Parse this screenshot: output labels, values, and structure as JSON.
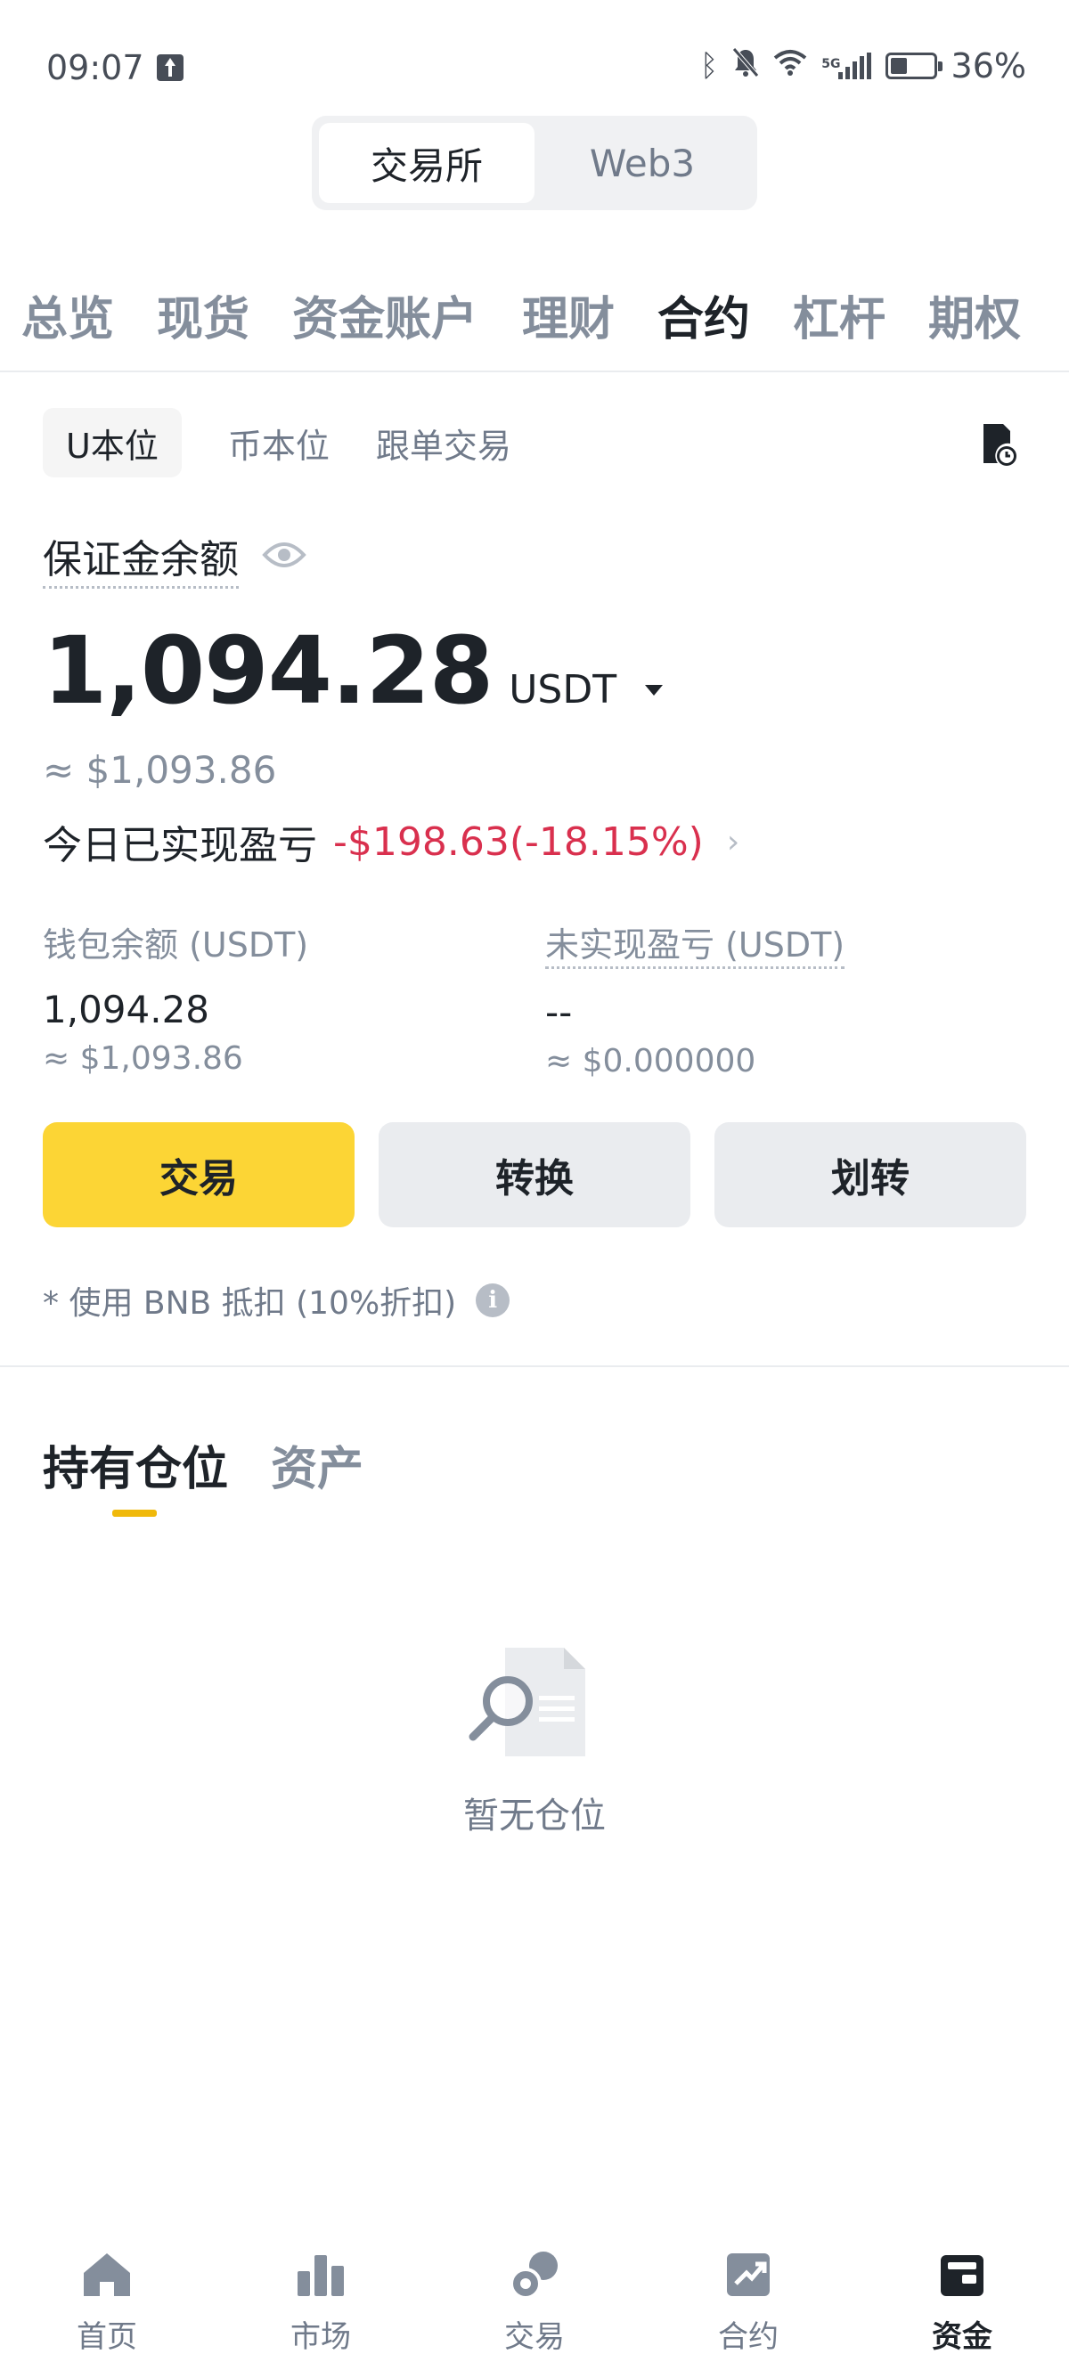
{
  "status_bar": {
    "time": "09:07",
    "network": "5G",
    "battery": "36%"
  },
  "segment": {
    "items": [
      "交易所",
      "Web3"
    ],
    "active_index": 0
  },
  "main_tabs": [
    "总览",
    "现货",
    "资金账户",
    "理财",
    "合约",
    "杠杆",
    "期权"
  ],
  "main_tab_active": "合约",
  "sub_tabs": [
    "U本位",
    "币本位",
    "跟单交易"
  ],
  "sub_tab_active": "U本位",
  "balance": {
    "label": "保证金余额",
    "value": "1,094.28",
    "unit": "USDT",
    "usd": "≈ $1,093.86",
    "pnl_label": "今日已实现盈亏",
    "pnl_value": "-$198.63(-18.15%)"
  },
  "wallet": {
    "label": "钱包余额 (USDT)",
    "value": "1,094.28",
    "usd": "≈ $1,093.86"
  },
  "unrealized": {
    "label": "未实现盈亏 (USDT)",
    "value": "--",
    "usd": "≈ $0.000000"
  },
  "actions": {
    "trade": "交易",
    "convert": "转换",
    "transfer": "划转"
  },
  "bnb_note": "* 使用 BNB 抵扣 (10%折扣)",
  "position_tabs": [
    "持有仓位",
    "资产"
  ],
  "position_tab_active": "持有仓位",
  "empty_text": "暂无仓位",
  "bottom_nav": [
    {
      "label": "首页",
      "icon": "home-icon"
    },
    {
      "label": "市场",
      "icon": "market-icon"
    },
    {
      "label": "交易",
      "icon": "trade-icon"
    },
    {
      "label": "合约",
      "icon": "futures-icon"
    },
    {
      "label": "资金",
      "icon": "wallet-icon"
    }
  ],
  "bottom_nav_active": "资金",
  "colors": {
    "accent": "#fcd535",
    "loss": "#d9304e",
    "underline": "#f0b90b"
  }
}
